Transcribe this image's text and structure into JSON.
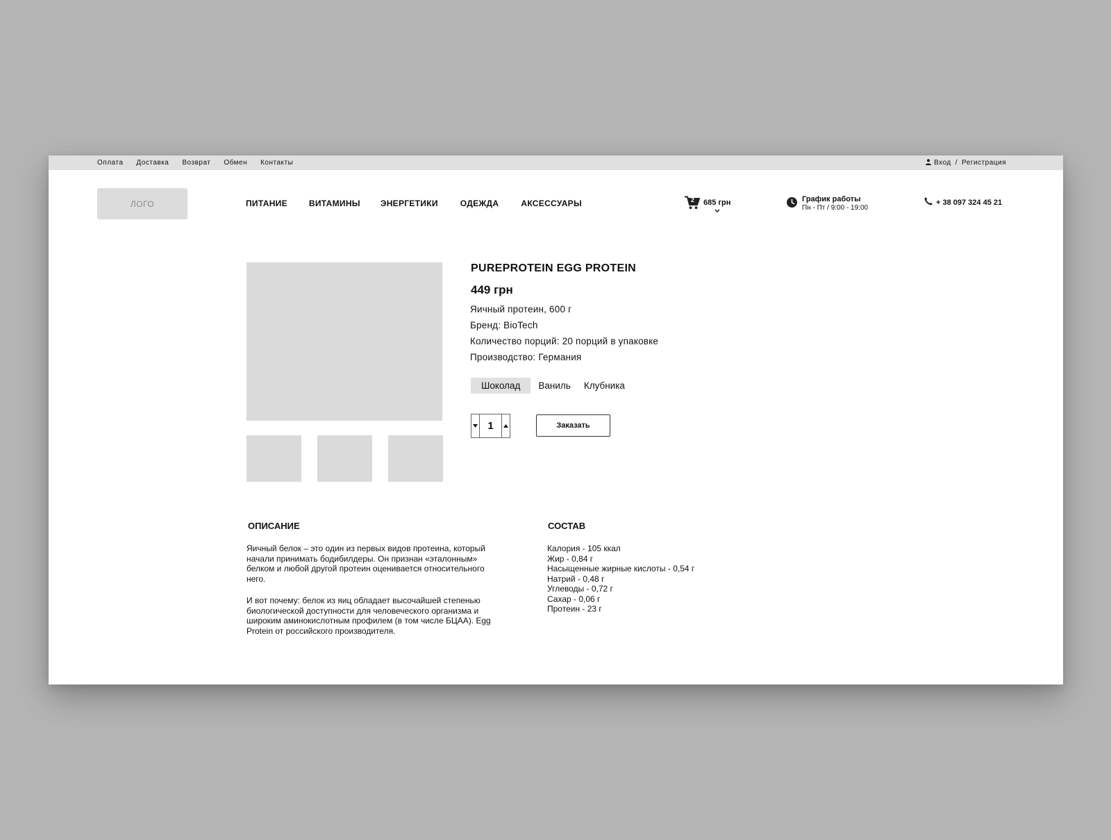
{
  "topbar": {
    "links": [
      "Оплата",
      "Доставка",
      "Возврат",
      "Обмен",
      "Контакты"
    ],
    "login": "Вход",
    "separator": "/",
    "register": "Регистрация"
  },
  "header": {
    "logo": "ЛОГО",
    "nav": [
      "ПИТАНИЕ",
      "ВИТАМИНЫ",
      "ЭНЕРГЕТИКИ",
      "ОДЕЖДА",
      "АКСЕССУАРЫ"
    ],
    "cart": {
      "count": "2",
      "total": "685 грн"
    },
    "hours": {
      "title": "График работы",
      "value": "Пн - Пт / 9:00 - 19:00"
    },
    "phone": "+ 38 097 324 45 21"
  },
  "product": {
    "title": "PUREPROTEIN EGG PROTEIN",
    "price": "449 грн",
    "specs": [
      "Яичный протеин, 600 г",
      "Бренд: BioTech",
      "Количество порций: 20 порций в упаковке",
      "Производство: Германия"
    ],
    "flavors": [
      "Шоколад",
      "Ваниль",
      "Клубника"
    ],
    "selected_flavor": "Шоколад",
    "quantity": "1",
    "order_label": "Заказать"
  },
  "description": {
    "title": "ОПИСАНИЕ",
    "paragraphs": [
      "Яичный белок – это один из первых видов протеина, который начали принимать бодибилдеры. Он признан «эталонным» белком и любой другой протеин оценивается относительного него.",
      "И вот почему: белок из яиц обладает высочайшей степенью биологической доступности для человеческого организма и широким аминокислотным профилем (в том числе БЦАА). Egg Protein от российского производителя."
    ]
  },
  "composition": {
    "title": "СОСТАВ",
    "items": [
      "Калория - 105 ккал",
      "Жир - 0,84 г",
      "Насыщенные жирные кислоты - 0,54 г",
      "Натрий - 0,48 г",
      "Углеводы - 0,72 г",
      "Сахар - 0,06 г",
      "Протеин - 23 г"
    ]
  },
  "icons": {
    "user": "user-icon",
    "cart": "cart-icon",
    "chevron": "chevron-down-icon",
    "clock": "clock-icon",
    "phone": "phone-icon",
    "decrement": "triangle-down-icon",
    "increment": "triangle-up-icon"
  },
  "colors": {
    "background": "#b5b5b5",
    "topbar": "#e0e0e0",
    "placeholder": "#dadada",
    "selected_flavor_bg": "#e0e0e0",
    "text": "#111111"
  }
}
